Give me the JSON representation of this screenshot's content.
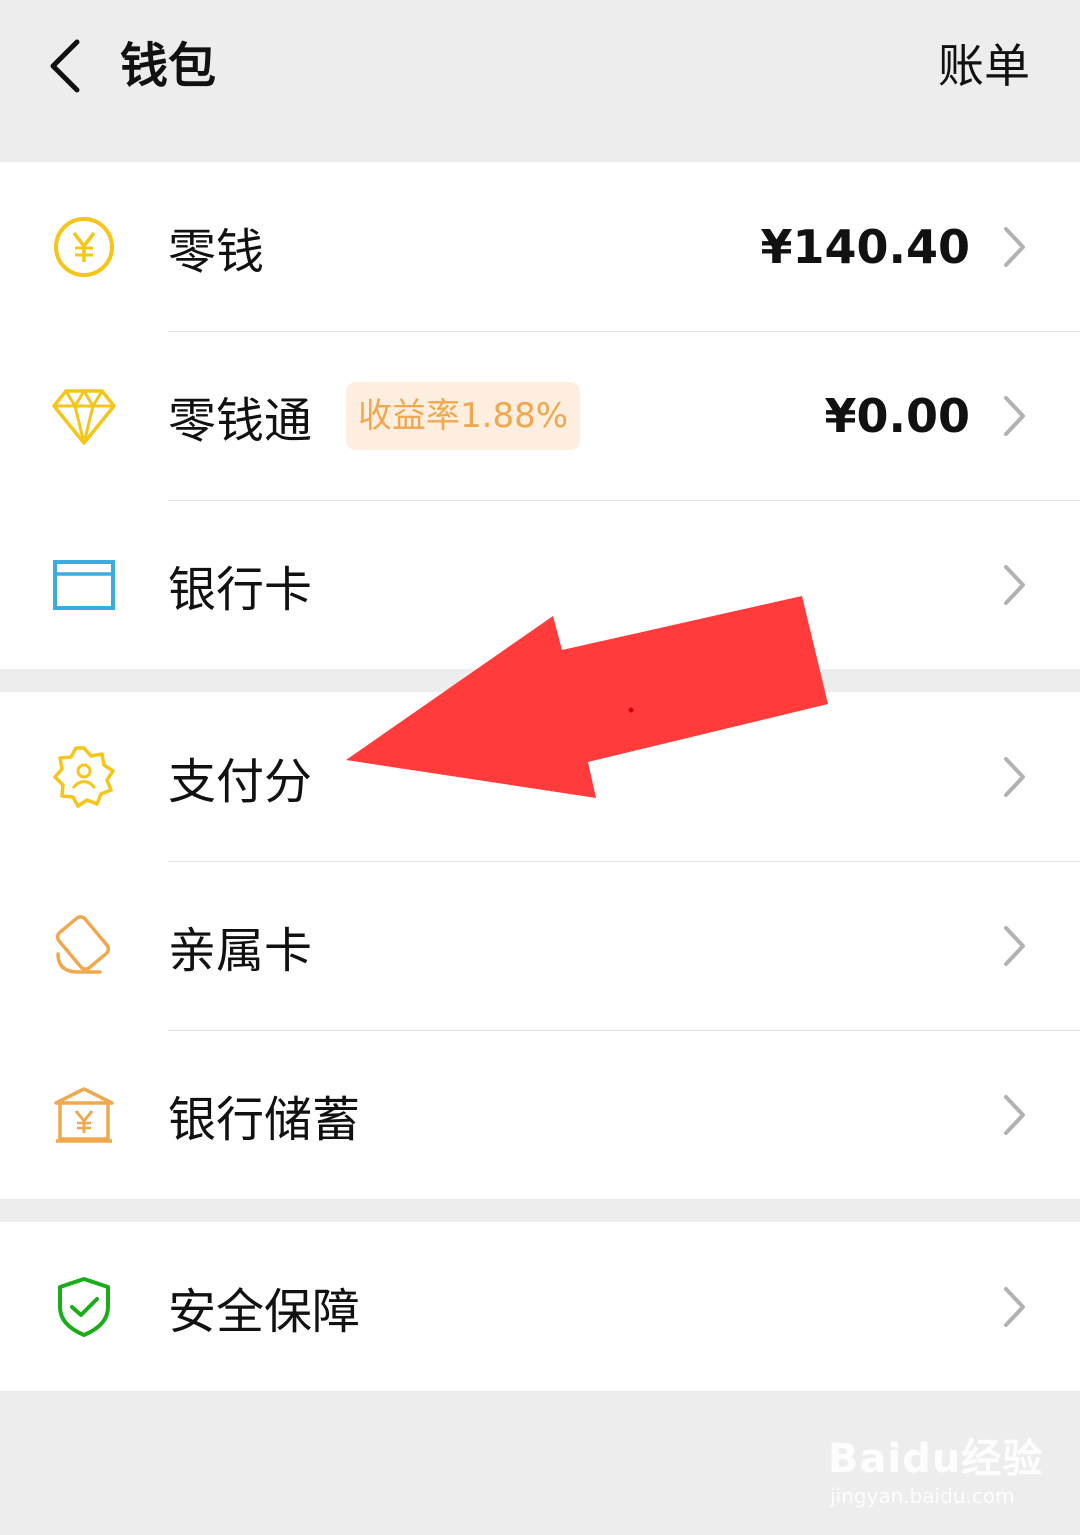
{
  "header": {
    "title": "钱包",
    "bill_label": "账单"
  },
  "groups": [
    {
      "items": [
        {
          "label": "零钱",
          "value": "¥140.40",
          "icon": "yuan-coin-icon"
        },
        {
          "label": "零钱通",
          "badge": "收益率1.88%",
          "value": "¥0.00",
          "icon": "diamond-icon"
        },
        {
          "label": "银行卡",
          "icon": "bank-card-icon"
        }
      ]
    },
    {
      "items": [
        {
          "label": "支付分",
          "icon": "pay-score-badge-icon"
        },
        {
          "label": "亲属卡",
          "icon": "family-card-icon"
        },
        {
          "label": "银行储蓄",
          "icon": "bank-savings-icon"
        }
      ]
    },
    {
      "items": [
        {
          "label": "安全保障",
          "icon": "security-shield-icon"
        }
      ]
    }
  ],
  "annotation": {
    "arrow_color": "#ff3b3b",
    "target": "支付分"
  },
  "watermark": {
    "main": "Baidu经验",
    "sub": "jingyan.baidu.com"
  },
  "colors": {
    "background": "#ededed",
    "yellow": "#f5c518",
    "orange": "#f0a84e",
    "blue": "#3bace2",
    "green": "#1aad19"
  }
}
